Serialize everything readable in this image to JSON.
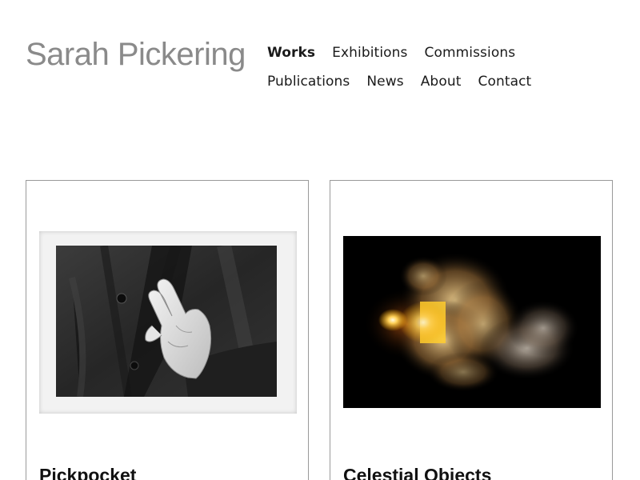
{
  "site": {
    "title": "Sarah Pickering"
  },
  "nav": {
    "row1": [
      {
        "label": "Works",
        "active": true
      },
      {
        "label": "Exhibitions",
        "active": false
      },
      {
        "label": "Commissions",
        "active": false
      }
    ],
    "row2": [
      {
        "label": "Publications",
        "active": false
      },
      {
        "label": "News",
        "active": false
      },
      {
        "label": "About",
        "active": false
      },
      {
        "label": "Contact",
        "active": false
      }
    ]
  },
  "works": [
    {
      "title": "Pickpocket"
    },
    {
      "title": "Celestial Objects"
    }
  ]
}
